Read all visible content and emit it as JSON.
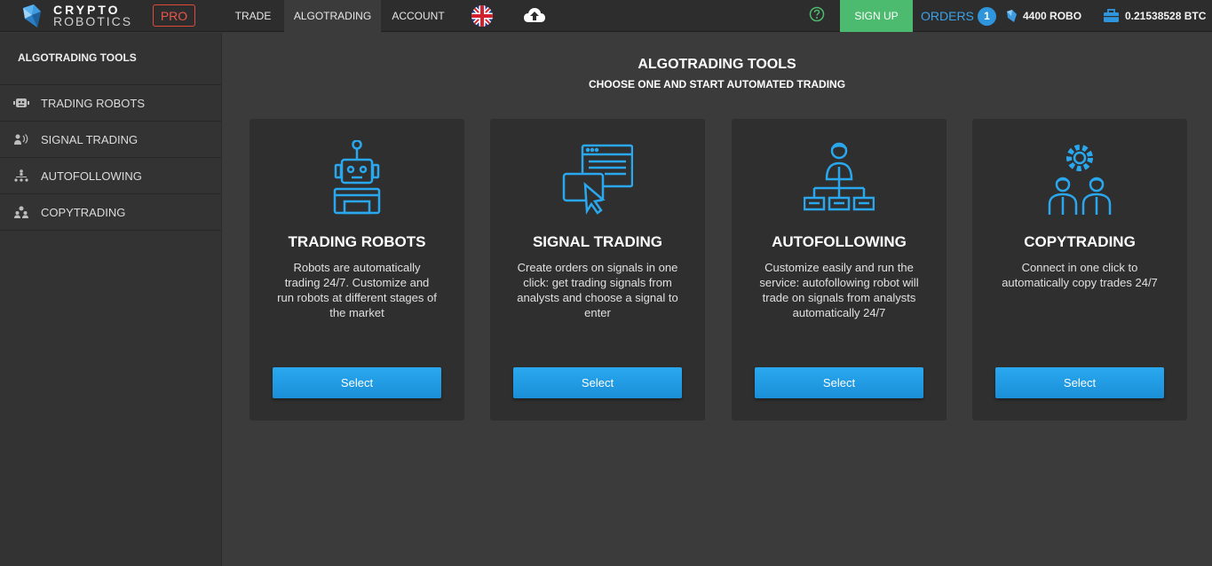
{
  "brand": {
    "line1": "CRYPTO",
    "line2": "ROBOTICS",
    "badge": "PRO"
  },
  "nav": {
    "trade": "TRADE",
    "algotrading": "ALGOTRADING",
    "account": "ACCOUNT"
  },
  "header": {
    "signup": "SIGN UP",
    "orders_label": "ORDERS",
    "orders_count": "1",
    "robo_balance": "4400 ROBO",
    "btc_balance": "0.21538528 BTC"
  },
  "sidebar": {
    "title": "ALGOTRADING TOOLS",
    "items": [
      {
        "label": "TRADING ROBOTS"
      },
      {
        "label": "SIGNAL TRADING"
      },
      {
        "label": "AUTOFOLLOWING"
      },
      {
        "label": "COPYTRADING"
      }
    ]
  },
  "main": {
    "title": "ALGOTRADING TOOLS",
    "subtitle": "CHOOSE ONE AND START AUTOMATED TRADING",
    "cards": [
      {
        "title": "TRADING ROBOTS",
        "description": "Robots are automatically trading 24/7. Customize and run robots at different stages of the market",
        "button": "Select"
      },
      {
        "title": "SIGNAL TRADING",
        "description": "Create orders on signals in one click: get trading signals from analysts and choose a signal to enter",
        "button": "Select"
      },
      {
        "title": "AUTOFOLLOWING",
        "description": "Customize easily and run the service: autofollowing robot will trade on signals from analysts automatically 24/7",
        "button": "Select"
      },
      {
        "title": "COPYTRADING",
        "description": "Connect in one click to automatically copy trades 24/7",
        "button": "Select"
      }
    ]
  },
  "colors": {
    "accent": "#2aa8ef",
    "signup": "#4dbb6f",
    "pro": "#e14b3b",
    "background": "#3b3b3b"
  }
}
